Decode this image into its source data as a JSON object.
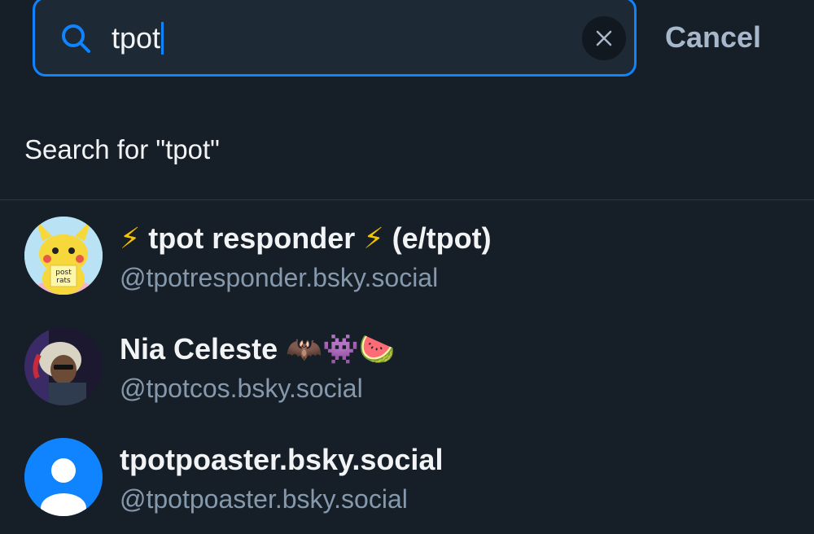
{
  "search": {
    "query": "tpot",
    "cancel_label": "Cancel",
    "search_for_label": "Search for \"tpot\""
  },
  "results": [
    {
      "name_prefix": "⚡",
      "name_main": "tpot responder",
      "name_mid": "⚡",
      "name_suffix": "(e/tpot)",
      "handle": "@tpotresponder.bsky.social",
      "avatar_text_line1": "post",
      "avatar_text_line2": "rats",
      "avatar_icon": "pikachu-avatar"
    },
    {
      "name_main": "Nia Celeste",
      "name_emoji": "🦇👾🍉",
      "handle": "@tpotcos.bsky.social",
      "avatar_icon": "photo-avatar"
    },
    {
      "name_main": "tpotpoaster.bsky.social",
      "handle": "@tpotpoaster.bsky.social",
      "avatar_icon": "default-user-avatar"
    }
  ],
  "colors": {
    "background": "#161e27",
    "accent": "#1083fe",
    "muted_text": "#8699ac"
  }
}
